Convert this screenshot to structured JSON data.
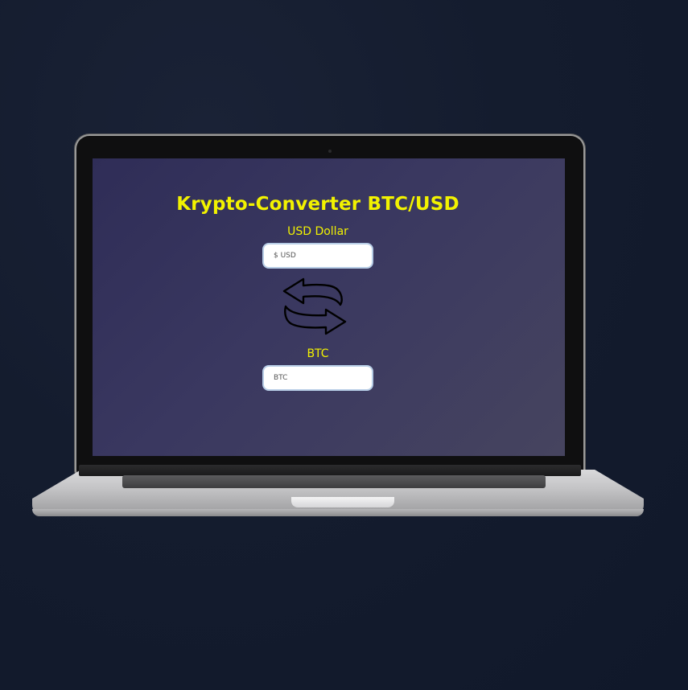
{
  "app": {
    "title": "Krypto-Converter BTC/USD"
  },
  "usd": {
    "label": "USD Dollar",
    "placeholder": "$ USD",
    "value": ""
  },
  "btc": {
    "label": "BTC",
    "placeholder": "BTC",
    "value": ""
  },
  "swap": {
    "icon": "swap-arrows-icon"
  },
  "colors": {
    "title": "#f2f200",
    "label": "#f2f200",
    "screen_bg": "#3a3860",
    "page_bg": "#141c2e",
    "field_border": "#b7cde6"
  }
}
